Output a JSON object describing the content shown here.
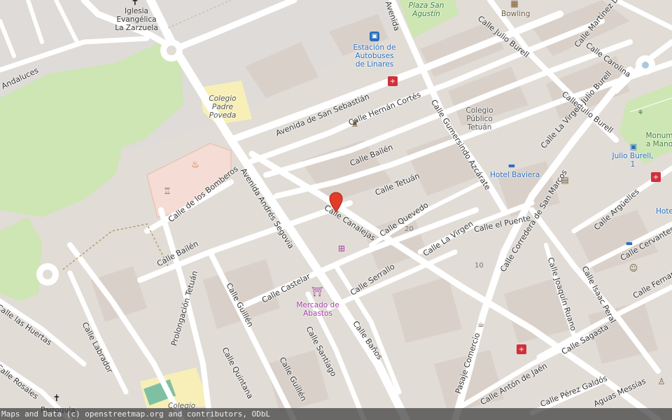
{
  "map": {
    "streets": {
      "andaluces": "Andaluces",
      "avenida_san_sebastian": "Avenida de San Sebastián",
      "calle_hernan_cortes": "Calle Hernán Cortés",
      "avenida_top": "Avenida",
      "calle_julio_burell_top": "Calle Julio Burell",
      "calle_martinez": "Calle Martínez D",
      "calle_carolina": "Calle Carolina",
      "calle_julio_burell_right": "Calle Julio Burell",
      "calle_gumersindo_azcarate": "Calle Gumersindo Azcárate",
      "calle_bailen_top": "Calle Bailén",
      "calle_la_virgen_julio_burell": "Calle La Virgen Julio Burell",
      "calle_de_los_bomberos": "Calle de los Bomberos",
      "avenida_andres_segovia": "Avenida Andrés Segovia",
      "calle_tetuan": "Calle Tetuán",
      "calle_canalejas": "Calle Canalejas",
      "calle_quevedo": "Calle Quevedo",
      "calle_la_virgen": "Calle La Virgen",
      "calle_el_puente": "Calle el Puente",
      "calle_corredera_san_marcos": "Calle Corredera de San Marcos",
      "calle_arguelles": "Calle Argüelles",
      "calle_cervantes": "Calle Cervantes",
      "calle_bailen_left": "Calle Bailén",
      "calle_castelar": "Calle Castelar",
      "calle_serrallo": "Calle Serrallo",
      "calle_joaquin_ruano": "Calle Joaquín Ruano",
      "calle_isaac_peral": "Calle Isaac Peral",
      "calle_fernando": "Calle Fernand",
      "calle_las_huertas": "Calle las Huertas",
      "calle_labrador": "Calle Labrador",
      "prolongacion_tetuan": "Prolongación Tetuán",
      "calle_guillen_1": "Calle Guillén",
      "calle_santiago": "Calle Santiago",
      "calle_banos": "Calle Baños",
      "calle_sagasta": "Calle Sagasta",
      "calle_rosales": "Calle Rosales",
      "calle_quintana": "Calle Quintana",
      "calle_guillen_2": "Calle Guillén",
      "pasaje_comercio": "Pasaje Comercio",
      "calle_anton_de_jaen": "Calle Antón de Jaén",
      "calle_perez_galdos": "Calle Pérez Galdós",
      "calle_aguas_messias": "Aguas Messías"
    },
    "pois": {
      "iglesia": "Iglesia Evangélica La Zarzuela",
      "plaza_san_agustin": "Plaza San Agustín",
      "bowling": "Bowling",
      "estacion": "Estación de Autobuses de Linares",
      "colegio_padre_poveda": "Colegio Padre Poveda",
      "colegio_tetuan": "Colegio Público Tetuán",
      "hotel_baviera": "Hotel Baviera",
      "julio_burell": "Julio Burell, 1",
      "monumento": "Monum a Mano",
      "hotel_right": "Hote",
      "mercado": "Mercado de Abastos",
      "colegio_bottom": "Colegio",
      "parroquia": "Parroquia"
    },
    "house_numbers": [
      "20",
      "10"
    ]
  },
  "attribution": {
    "text": "Maps and Data (c) openstreetmap.org and contributors, ODbL"
  },
  "colors": {
    "background": "#e1dcd6",
    "road": "#ffffff",
    "park": "#cde6b3",
    "grass_dark": "#aed1a0",
    "school": "#f7efb7",
    "fire_station": "#f5dcd4",
    "marker": "#e23b2a"
  }
}
